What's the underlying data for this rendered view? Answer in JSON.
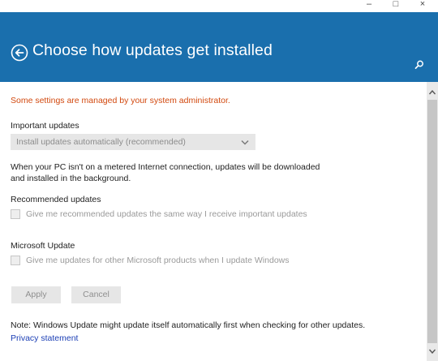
{
  "window": {
    "minimize_glyph": "–",
    "maximize_glyph": "□",
    "close_glyph": "×"
  },
  "header": {
    "title": "Choose how updates get installed",
    "back_icon": "back-arrow-circle-icon",
    "search_icon": "search-icon",
    "background_color": "#1a6fad"
  },
  "content": {
    "admin_notice": "Some settings are managed by your system administrator.",
    "admin_notice_color": "#d2490f",
    "important_updates": {
      "label": "Important updates",
      "selected_value": "Install updates automatically (recommended)"
    },
    "description": "When your PC isn't on a metered Internet connection, updates will be downloaded and installed in the background.",
    "recommended_updates": {
      "label": "Recommended updates",
      "checkbox_label": "Give me recommended updates the same way I receive important updates",
      "checked": false
    },
    "microsoft_update": {
      "label": "Microsoft Update",
      "checkbox_label": "Give me updates for other Microsoft products when I update Windows",
      "checked": false
    },
    "buttons": {
      "apply": "Apply",
      "cancel": "Cancel"
    },
    "note": "Note: Windows Update might update itself automatically first when checking for other updates.",
    "privacy_link": "Privacy statement",
    "link_color": "#1c3fb5"
  }
}
